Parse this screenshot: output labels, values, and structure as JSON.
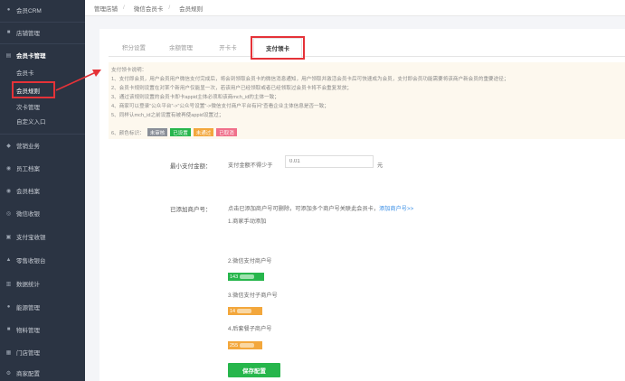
{
  "colors": {
    "sidebar_bg": "#2b3443",
    "highlight_red": "#e53238",
    "notes_bg": "#fdf8ee",
    "green": "#27b64c",
    "orange": "#f3a73c",
    "pink": "#f0708a",
    "gray_badge": "#8a8f98",
    "link_blue": "#3b8fe6"
  },
  "topbar": {
    "crumb1": "管理店铺",
    "crumb2": "微信会员卡",
    "crumb3": "会员规则"
  },
  "sidebar": {
    "items": [
      {
        "label": "会员CRM",
        "icon": "crm-icon"
      },
      {
        "label": "店铺管理",
        "icon": "store-icon"
      },
      {
        "label": "会员卡管理",
        "icon": "card-icon"
      }
    ],
    "subitems": [
      {
        "label": "会员卡"
      },
      {
        "label": "会员规则"
      },
      {
        "label": "次卡管理"
      },
      {
        "label": "自定义入口"
      }
    ],
    "lower_items": [
      {
        "label": "营销业务",
        "icon": "marketing-icon"
      },
      {
        "label": "员工档案",
        "icon": "staff-icon"
      },
      {
        "label": "会员档案",
        "icon": "member-icon"
      },
      {
        "label": "微信收银",
        "icon": "wechat-pay-icon"
      },
      {
        "label": "支付宝收银",
        "icon": "alipay-icon"
      },
      {
        "label": "零售收银台",
        "icon": "pos-icon"
      },
      {
        "label": "数据统计",
        "icon": "stats-icon"
      },
      {
        "label": "能源管理",
        "icon": "energy-icon"
      },
      {
        "label": "物料管理",
        "icon": "material-icon"
      },
      {
        "label": "门店管理",
        "icon": "shop-icon"
      },
      {
        "label": "商家配置",
        "icon": "config-icon"
      }
    ]
  },
  "tabs": [
    {
      "label": "积分设置"
    },
    {
      "label": "余额管理"
    },
    {
      "label": "开卡卡"
    },
    {
      "label": "支付领卡"
    }
  ],
  "notes": {
    "title": "支付领卡说明：",
    "lines": [
      "1、支付即会员，用户会员用户微信支付完成后，将会到领取会员卡的微信消息通知，用户领取并激活会员卡后可快速成为会员，支付即会员功能需要将该商户新会员的重要途径；",
      "2、会员卡规则设置在对某个新用户仅能显一次，若该用户已经领取或者已经领取过会员卡将不会重复发放；",
      "3、通过该规则设置的会员卡即卡appid主体必须和该商mch_id的主体一致；",
      "4、商家可以登录“公众平台”->“公众号设置”->微信支付商户平台有问“查看企业主体信息是否一致；",
      "5、同样认mch_id之前设置有被再使appid设置过；"
    ],
    "legend_label": "6、颜色标识：",
    "badges": [
      {
        "label": "未审核"
      },
      {
        "label": "已设置"
      },
      {
        "label": "未通过"
      },
      {
        "label": "已取消"
      }
    ]
  },
  "form": {
    "min_pay_label": "最小支付金额：",
    "min_pay_prefix": "支付金额不得少于",
    "min_pay_placeholder": "0.01",
    "min_pay_unit": "元",
    "merchant_label": "已添加商户号：",
    "merchant_hint": "点击已添加商户号可删除，可添加多个商户号关联此会员卡，",
    "merchant_add_link": "添加商户号>>",
    "groups": [
      {
        "title": "1.商家手动添加"
      },
      {
        "title": "2.微信支付商户号",
        "chip": "143"
      },
      {
        "title": "3.微信支付子商户号",
        "chip": "14"
      },
      {
        "title": "4.后套餐子商户号",
        "chip": "255"
      }
    ],
    "save_label": "保存配置"
  }
}
